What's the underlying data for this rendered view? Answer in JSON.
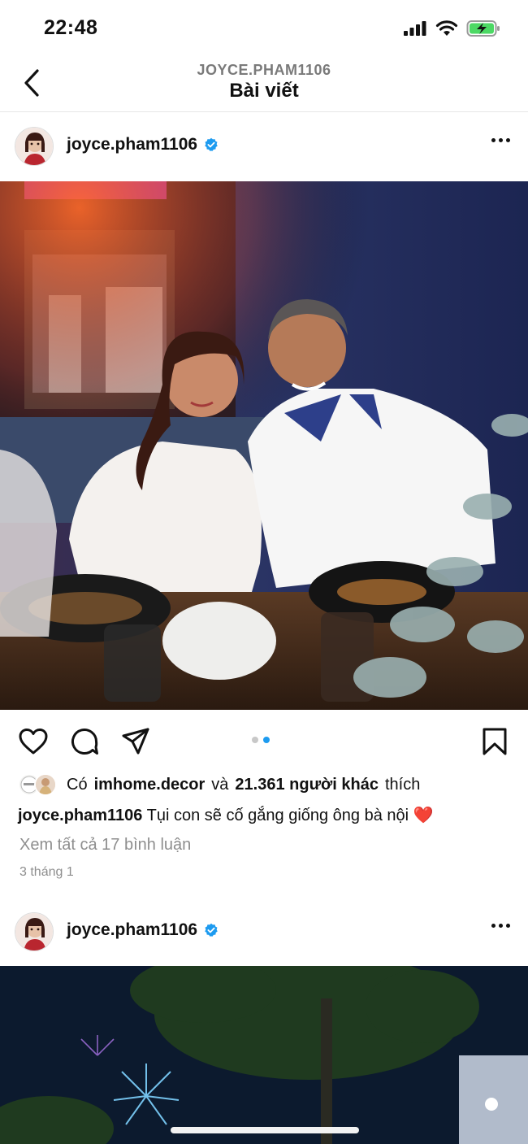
{
  "status_bar": {
    "time": "22:48",
    "icons": [
      "signal-icon",
      "wifi-icon",
      "battery-charging-icon"
    ]
  },
  "header": {
    "subtitle": "JOYCE.PHAM1106",
    "title": "Bài viết"
  },
  "post": {
    "username": "joyce.pham1106",
    "verified": true,
    "carousel": {
      "count": 2,
      "active_index": 1
    },
    "likes": {
      "prefix": "Có",
      "first_liker": "imhome.decor",
      "conj": "và",
      "others": "21.361 người khác",
      "suffix": "thích"
    },
    "caption": {
      "username": "joyce.pham1106",
      "text": "Tụi con sẽ cố gắng giống ông bà nội",
      "emoji": "❤️"
    },
    "comments_link": "Xem tất cả 17 bình luận",
    "date": "3 tháng 1"
  },
  "next_post": {
    "username": "joyce.pham1106",
    "verified": true
  },
  "colors": {
    "accent_blue": "#1d9bf0",
    "battery_green": "#4cd964",
    "heart_red": "#e0245e"
  }
}
